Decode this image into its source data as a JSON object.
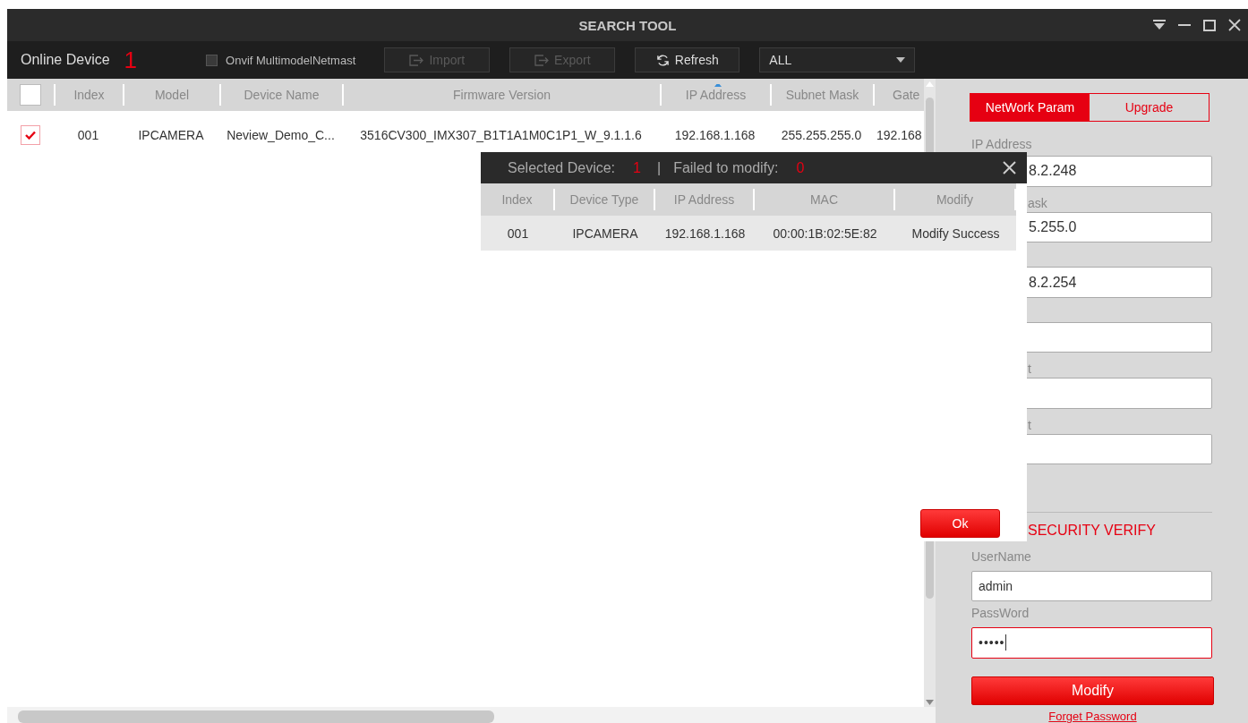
{
  "window": {
    "title": "SEARCH TOOL"
  },
  "toolbar": {
    "label": "Online Device",
    "count": "1",
    "onvif": {
      "label": "Onvif MultimodelNetmast",
      "checked": false
    },
    "buttons": [
      {
        "label": "Import",
        "kind": "import",
        "disabled": true
      },
      {
        "label": "Export",
        "kind": "export",
        "disabled": true
      },
      {
        "label": "Refresh",
        "kind": "refresh",
        "disabled": false
      }
    ],
    "filter": {
      "value": "ALL"
    }
  },
  "table": {
    "all_checked": false,
    "columns": [
      {
        "label": "Index",
        "sorted": false
      },
      {
        "label": "Model",
        "sorted": false
      },
      {
        "label": "Device Name",
        "sorted": false
      },
      {
        "label": "Firmware Version",
        "sorted": false
      },
      {
        "label": "IP Address",
        "sorted": true
      },
      {
        "label": "Subnet Mask",
        "sorted": false
      },
      {
        "label": "Gate",
        "sorted": false
      }
    ],
    "rows": [
      {
        "checked": true,
        "cells": [
          "001",
          "IPCAMERA",
          "Neview_Demo_C...",
          "3516CV300_IMX307_B1T1A1M0C1P1_W_9.1.1.6",
          "192.168.1.168",
          "255.255.255.0",
          "192.168"
        ]
      }
    ]
  },
  "dialog": {
    "selected_label": "Selected Device:",
    "selected_count": "1",
    "separator": "|",
    "failed_label": "Failed to modify:",
    "failed_count": "0",
    "columns": [
      "Index",
      "Device Type",
      "IP Address",
      "MAC",
      "Modify"
    ],
    "rows": [
      {
        "cells": [
          "001",
          "IPCAMERA",
          "192.168.1.168",
          "00:00:1B:02:5E:82",
          "Modify Success"
        ]
      }
    ],
    "ok_button": "Ok"
  },
  "panel": {
    "tabs": [
      {
        "label": "NetWork Param",
        "selected": true
      },
      {
        "label": "Upgrade",
        "selected": false
      }
    ],
    "fields": [
      {
        "kind": "input",
        "label": "IP Address",
        "label_covered": false,
        "value": "8.2.248"
      },
      {
        "kind": "input",
        "label": "ask",
        "label_covered": true,
        "value": "5.255.0"
      },
      {
        "kind": "input",
        "value": "8.2.254"
      },
      {
        "kind": "input"
      },
      {
        "kind": "input",
        "label": "t",
        "label_covered": true
      },
      {
        "kind": "input",
        "label": "t",
        "label_covered": true
      }
    ],
    "security": {
      "title": "SECURITY VERIFY",
      "title_covered": true,
      "username_label": "UserName",
      "username": "admin",
      "password_label": "PassWord",
      "password": "•••••",
      "modify_button": "Modify",
      "forgot_link": "Forget Password"
    }
  }
}
